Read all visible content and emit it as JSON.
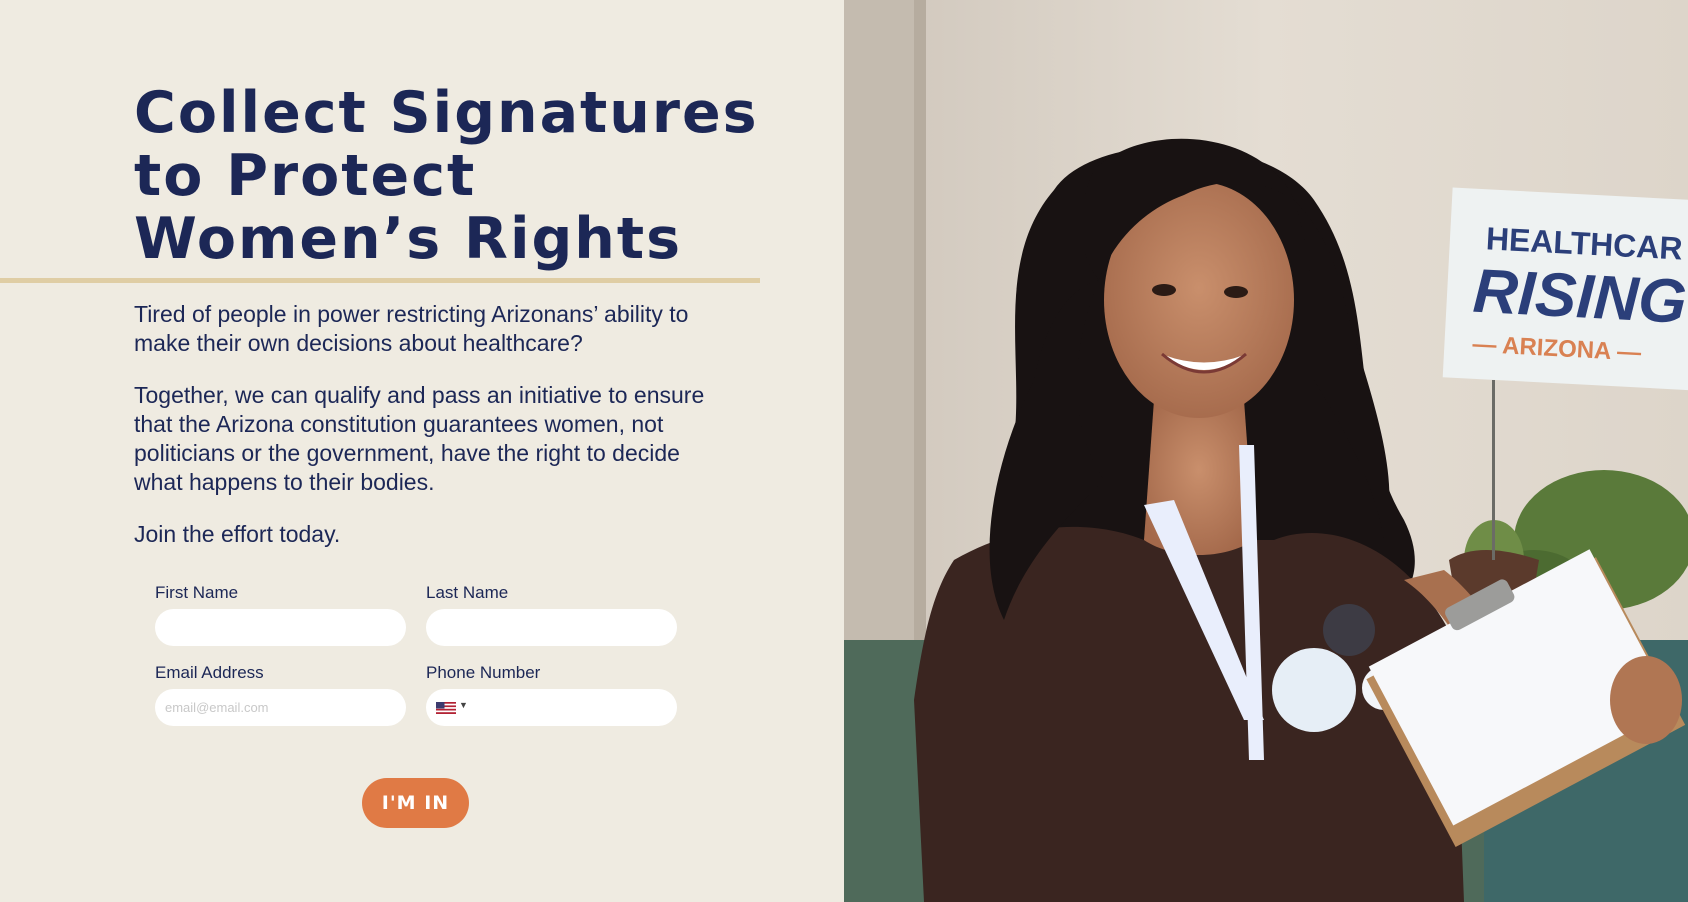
{
  "hero": {
    "headline_lines": [
      "Collect Signatures",
      "to Protect",
      "Women’s Rights"
    ],
    "paragraphs": [
      "Tired of people in power restricting Arizonans’ ability to make their own decisions about healthcare?",
      "Together, we can qualify and pass an initiative to ensure that the Arizona constitution guarantees women, not politicians or the government, have the right to decide what happens to their bodies.",
      "Join the effort today."
    ]
  },
  "form": {
    "first_name": {
      "label": "First Name",
      "value": "",
      "placeholder": ""
    },
    "last_name": {
      "label": "Last Name",
      "value": "",
      "placeholder": ""
    },
    "email": {
      "label": "Email Address",
      "value": "",
      "placeholder": "email@email.com"
    },
    "phone": {
      "label": "Phone Number",
      "value": "",
      "placeholder": "",
      "country_flag": "us-flag-icon"
    },
    "submit_label": "I'M IN"
  },
  "photo": {
    "sign_lines": [
      "HEALTHCAR",
      "RISING",
      "— ARIZONA —"
    ]
  },
  "colors": {
    "background": "#efebe1",
    "navy": "#1c2756",
    "gold_rule": "#dfcda4",
    "accent_orange": "#e07a45"
  }
}
